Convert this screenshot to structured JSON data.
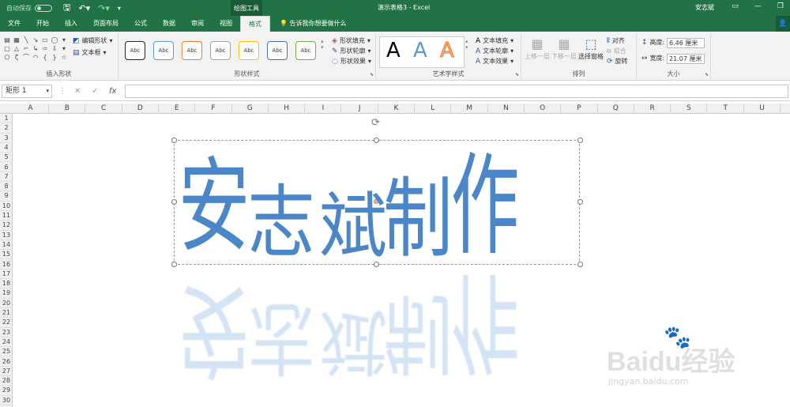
{
  "titlebar": {
    "autosave": "自动保存",
    "autosave_state": "关",
    "drawing_tools": "绘图工具",
    "doc_title": "演示表格3  -  Excel",
    "user": "安志斌"
  },
  "tabs": [
    "文件",
    "开始",
    "插入",
    "页面布局",
    "公式",
    "数据",
    "审阅",
    "视图",
    "格式"
  ],
  "active_tab": "格式",
  "tell_me": "告诉我你想要做什么",
  "ribbon": {
    "insert_shapes": {
      "label": "插入形状",
      "edit_shape": "编辑形状",
      "text_box": "文本框"
    },
    "shape_styles": {
      "label": "形状样式",
      "items": [
        "Abc",
        "Abc",
        "Abc",
        "Abc",
        "Abc",
        "Abc",
        "Abc"
      ],
      "fill": "形状填充",
      "outline": "形状轮廓",
      "effects": "形状效果"
    },
    "wordart_styles": {
      "label": "艺术字样式",
      "samples": [
        "A",
        "A",
        "A"
      ],
      "text_fill": "文本填充",
      "text_outline": "文本轮廓",
      "text_effects": "文本效果"
    },
    "arrange": {
      "label": "排列",
      "bring_forward": "上移一层",
      "send_backward": "下移一层",
      "selection_pane": "选择窗格",
      "align": "对齐",
      "group": "组合",
      "rotate": "旋转"
    },
    "size": {
      "label": "大小",
      "height_label": "高度:",
      "height_value": "6.46 厘米",
      "width_label": "宽度:",
      "width_value": "21.07 厘米"
    }
  },
  "formula_bar": {
    "name_box": "矩形 1",
    "cancel": "✕",
    "enter": "✓",
    "fx": "fx",
    "value": ""
  },
  "columns": [
    "A",
    "B",
    "C",
    "D",
    "E",
    "F",
    "G",
    "H",
    "I",
    "J",
    "K",
    "L",
    "M",
    "N",
    "O",
    "P",
    "Q",
    "R",
    "S",
    "T",
    "U"
  ],
  "rows": [
    "1",
    "2",
    "3",
    "4",
    "5",
    "6",
    "7",
    "8",
    "9",
    "10",
    "11",
    "12",
    "13",
    "14",
    "15",
    "16",
    "17",
    "18",
    "19",
    "20",
    "21",
    "22",
    "23",
    "24",
    "25",
    "26",
    "27",
    "28",
    "29",
    "30"
  ],
  "wordart": {
    "text_chars": [
      "安",
      "志",
      "斌",
      "制",
      "作"
    ]
  },
  "watermark": {
    "logo": "Baidu经验",
    "url": "jingyan.baidu.com"
  }
}
